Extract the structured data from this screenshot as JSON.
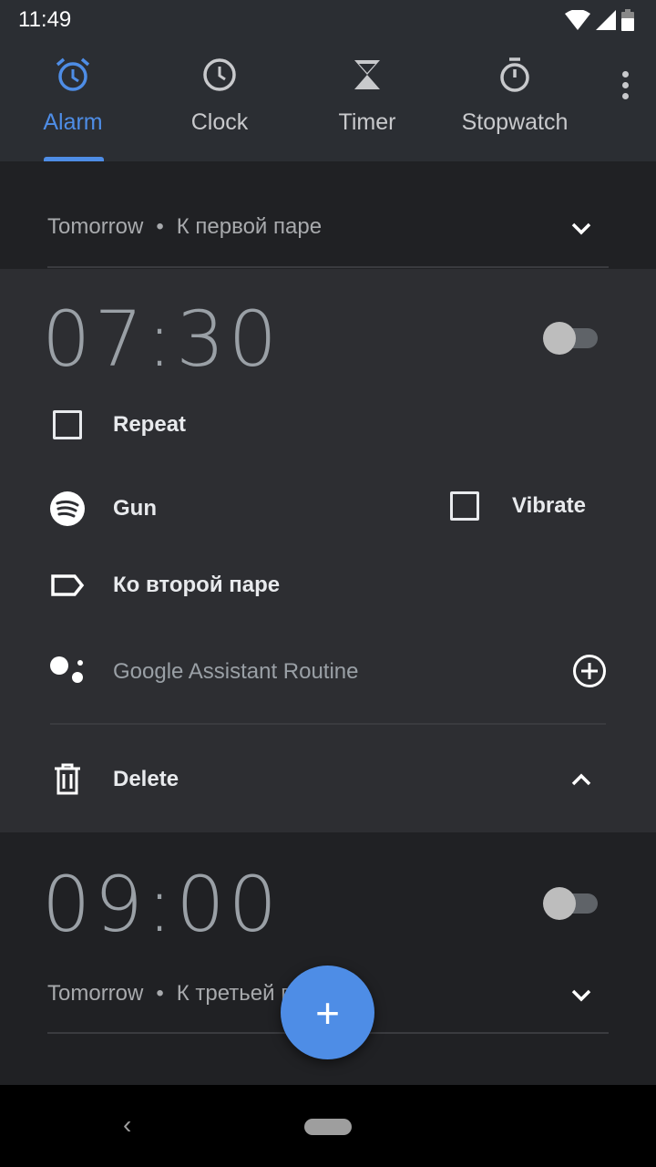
{
  "status_bar": {
    "time": "11:49"
  },
  "tabs": [
    {
      "label": "Alarm",
      "active": true
    },
    {
      "label": "Clock"
    },
    {
      "label": "Timer"
    },
    {
      "label": "Stopwatch"
    }
  ],
  "accent": "#4e8de6",
  "alarms": [
    {
      "day": "Tomorrow",
      "label": "К первой паре",
      "enabled": null
    },
    {
      "time": "07:30",
      "enabled": false,
      "repeat_label": "Repeat",
      "repeat": false,
      "sound": "Gun",
      "vibrate_label": "Vibrate",
      "vibrate": false,
      "label": "Ко второй паре",
      "assistant": "Google Assistant Routine",
      "delete_label": "Delete"
    },
    {
      "time": "09:00",
      "enabled": false,
      "day": "Tomorrow",
      "label": "К третьей паре"
    }
  ],
  "fab_label": "+",
  "meta_sep": "•",
  "nav": {
    "back": "‹"
  }
}
